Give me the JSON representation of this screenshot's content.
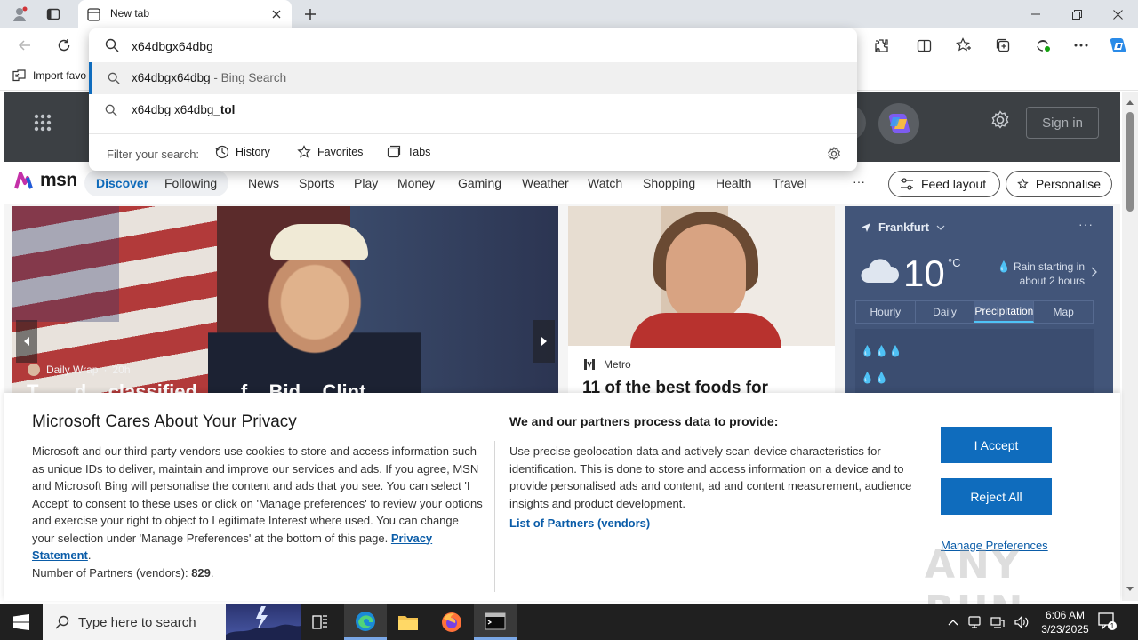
{
  "browser": {
    "tab_title": "New tab",
    "favorites_import": "Import favo"
  },
  "omnibox": {
    "query": "x64dbgx64dbg",
    "suggestions": [
      {
        "text": "x64dbgx64dbg",
        "suffix": " - Bing Search",
        "selected": true
      },
      {
        "text": "x64dbg x64dbg",
        "bold_suffix": "_tol",
        "selected": false
      }
    ],
    "filter_label": "Filter your search:",
    "filters": [
      "History",
      "Favorites",
      "Tabs"
    ]
  },
  "msn": {
    "sign_in": "Sign in",
    "nav": [
      "Discover",
      "Following",
      "News",
      "Sports",
      "Play",
      "Money",
      "Gaming",
      "Weather",
      "Watch",
      "Shopping",
      "Health",
      "Travel"
    ],
    "active_nav": "Discover",
    "more": "···",
    "feed_layout": "Feed layout",
    "personalise": "Personalise",
    "hero": {
      "source": "Daily Wrap",
      "age": "20h",
      "headline": "T... ...d ...classified ... ...f... Bid... Clint..."
    },
    "card2": {
      "source": "Metro",
      "headline": "11 of the best foods for"
    },
    "weather": {
      "location": "Frankfurt",
      "more": "···",
      "temp": "10",
      "unit": "°C",
      "description": "Rain starting in about 2 hours",
      "tabs": [
        "Hourly",
        "Daily",
        "Precipitation",
        "Map"
      ],
      "selected_tab": "Precipitation"
    }
  },
  "privacy": {
    "title": "Microsoft Cares About Your Privacy",
    "body": "Microsoft and our third-party vendors use cookies to store and access information such as unique IDs to deliver, maintain and improve our services and ads. If you agree, MSN and Microsoft Bing will personalise the content and ads that you see. You can select 'I Accept' to consent to these uses or click on 'Manage preferences' to review your options and exercise your right to object to Legitimate Interest where used.  You can change your selection under 'Manage Preferences' at the bottom of this page.",
    "privacy_link": "Privacy Statement",
    "partners_label": "Number of Partners (vendors): ",
    "partners_count": "829",
    "right_title": "We and our partners process data to provide:",
    "right_body": "Use precise geolocation data and actively scan device characteristics for identification. This is done to store and access information on a device and to provide personalised ads and content, ad and content measurement, audience insights and product development.",
    "partners_link": "List of Partners (vendors)",
    "accept": "I Accept",
    "reject": "Reject All",
    "manage": "Manage Preferences"
  },
  "watermark": "ANY RUN",
  "taskbar": {
    "search_placeholder": "Type here to search",
    "time": "6:06 AM",
    "date": "3/23/2025"
  },
  "colors": {
    "accent": "#0f6cbd",
    "msn_header": "#3c4044",
    "weather_bg": "#425579",
    "taskbar": "#202020"
  }
}
